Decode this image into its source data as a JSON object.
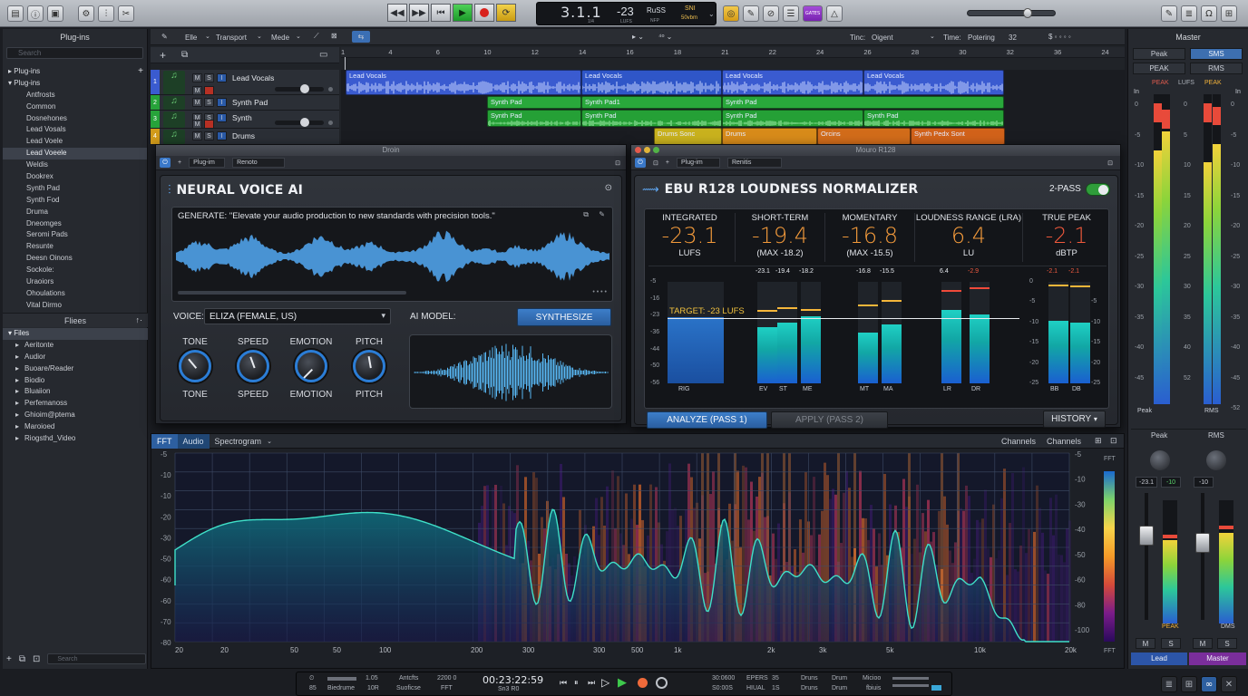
{
  "toolbar": {
    "lcd_position": "3.1.1",
    "lcd_position_sub": "1/4",
    "lcd_level": "-23",
    "lcd_level_sub": "LUFS",
    "lcd_field3": "RuSS",
    "lcd_field3_sub": "NFP",
    "lcd_field4": "SNI",
    "lcd_field4_sub": "50vbm",
    "gates_label": "GATES"
  },
  "sidebar": {
    "title": "Plug-ins",
    "search_placeholder": "Search",
    "tree_root": "Plug-ins",
    "tree_root2": "Plug-ins",
    "items": [
      "Antfrosts",
      "Common",
      "Dosnehones",
      "Lead Vosals",
      "Lead Voele",
      "Lead Voeele",
      "Weldis",
      "Dookrex",
      "Synth Pad",
      "Synth Fod",
      "Druma",
      "Dneomges",
      "Seromi Pads",
      "Resunte",
      "Deesn Oinons",
      "Sockole:",
      "Uraoiors",
      "Ohoulations",
      "Vital Dirmo"
    ],
    "files_title": "Fliees",
    "files_root": "Files",
    "files": [
      "Aeritonte",
      "Audior",
      "Buoare/Reader",
      "Biodio",
      "Bluaiion",
      "Perfemanoss",
      "Ghioim@ptema",
      "Maroioed",
      "Riogsthd_Video"
    ],
    "footer_search": "Search"
  },
  "arrange_toolbar": {
    "edit": "Elle",
    "transport": "Transport",
    "mode": "Mede",
    "time_label": "Tinc:",
    "time_value": "Oigent",
    "time2_label": "Time:",
    "time2_value": "Potering",
    "num": "32"
  },
  "ruler": [
    "1",
    "4",
    "6",
    "10",
    "12",
    "14",
    "16",
    "18",
    "21",
    "22",
    "24",
    "26",
    "28",
    "30",
    "32",
    "36",
    "24"
  ],
  "tracks": [
    {
      "num": "1",
      "name": "Lead Vocals",
      "color": "#3a5bd0"
    },
    {
      "num": "2",
      "name": "Synth Pad",
      "color": "#27a33a"
    },
    {
      "num": "3",
      "name": "Synth",
      "color": "#27a33a"
    },
    {
      "num": "4",
      "name": "Drums",
      "color": "#d19a1a"
    }
  ],
  "regions": {
    "vocal": [
      "Lead Vocals",
      "Lead Vocals",
      "Lead Vocals",
      "Lead Vocals"
    ],
    "synth1": [
      "Synth Pad",
      "Synth Pad1",
      "Synth Pad"
    ],
    "synth2": [
      "Synth Pad",
      "Synth Pad",
      "Synth Pad",
      "Synth Pad"
    ],
    "drums": [
      "Drums Sonc",
      "Drums",
      "Orcins",
      "Synth Pedx Sont"
    ]
  },
  "neural": {
    "window_title": "Droin",
    "bar_plugin": "Plug-im",
    "bar_preset": "Renoto",
    "title": "NEURAL VOICE AI",
    "prompt": "GENERATE: \"Elevate your audio production to new standards with precision tools.\"",
    "voice_label": "VOICE:",
    "voice_value": "ELIZA (FEMALE, US)",
    "model_label": "AI MODEL:",
    "synth_button": "SYNTHESIZE",
    "knobs": [
      {
        "top": "TONE",
        "bottom": "TONE",
        "angle": -40
      },
      {
        "top": "SPEED",
        "bottom": "SPEED",
        "angle": -20
      },
      {
        "top": "EMOTION",
        "bottom": "EMOTION",
        "angle": -135
      },
      {
        "top": "PITCH",
        "bottom": "PITCH",
        "angle": -10
      }
    ]
  },
  "ebu": {
    "window_title": "Mouro R128",
    "bar_plugin": "Plug-im",
    "bar_preset": "Renitis",
    "title": "EBU R128 LOUDNESS NORMALIZER",
    "two_pass": "2-PASS",
    "metrics": [
      {
        "label": "INTEGRATED",
        "value": "-23.1",
        "sub": "LUFS"
      },
      {
        "label": "SHORT-TERM",
        "value": "-19.4",
        "sub": "(MAX -18.2)"
      },
      {
        "label": "MOMENTARY",
        "value": "-16.8",
        "sub": "(MAX -15.5)"
      },
      {
        "label": "LOUDNESS RANGE (LRA)",
        "value": "6.4",
        "sub": "LU"
      },
      {
        "label": "TRUE PEAK",
        "value": "-2.1",
        "sub": "dBTP"
      }
    ],
    "target": "TARGET: -23 LUFS",
    "scale_left": [
      "-5",
      "-16",
      "-23",
      "-36",
      "-44",
      "-50",
      "-56"
    ],
    "scale_right": [
      "0",
      "-5",
      "-10",
      "-15",
      "-20",
      "-25"
    ],
    "scale_right2": [
      "-5",
      "-10",
      "-15",
      "-20",
      "-25"
    ],
    "groups": [
      {
        "label": "RIG",
        "bars": [
          {
            "lab": "",
            "level": 0.65,
            "peak": null
          }
        ]
      },
      {
        "label": "EV",
        "bars": [
          {
            "lab": "-23.1",
            "level": 0.55,
            "peak": 0.72
          }
        ]
      },
      {
        "label": "ST",
        "bars": [
          {
            "lab": "-19.4",
            "level": 0.6,
            "peak": 0.75
          }
        ]
      },
      {
        "label": "ME",
        "bars": [
          {
            "lab": "-18.2",
            "level": 0.66,
            "peak": 0.73
          }
        ]
      },
      {
        "label": "MT",
        "bars": [
          {
            "lab": "-16.8",
            "level": 0.5,
            "peak": 0.78
          }
        ]
      },
      {
        "label": "MA",
        "bars": [
          {
            "lab": "-15.5",
            "level": 0.58,
            "peak": 0.82
          }
        ]
      },
      {
        "label": "LR",
        "bars": [
          {
            "lab": "6.4",
            "level": 0.72,
            "peak": 0.92
          }
        ]
      },
      {
        "label": "DR",
        "bars": [
          {
            "lab": "-2.9",
            "level": 0.68,
            "peak": 0.95
          }
        ]
      },
      {
        "label": "BB",
        "bars": [
          {
            "lab": "-2.1",
            "level": 0.62,
            "peak": 0.97
          }
        ]
      },
      {
        "label": "DB",
        "bars": [
          {
            "lab": "-2.1",
            "level": 0.6,
            "peak": 0.96
          }
        ]
      }
    ],
    "analyze_button": "ANALYZE (PASS 1)",
    "apply_button": "APPLY (PASS 2)",
    "history_button": "HISTORY"
  },
  "spectrum": {
    "tab_fft": "FFT",
    "tab_audio": "Audio",
    "tab_spectrogram": "Spectrogram",
    "channels1": "Channels",
    "channels2": "Channels",
    "y_left": [
      "-5",
      "-10",
      "-10",
      "-20",
      "-30",
      "-50",
      "-60",
      "-60",
      "-70",
      "-80"
    ],
    "y_right": [
      "-5",
      "-10",
      "-30",
      "-40",
      "-50",
      "-60",
      "-80",
      "-100"
    ],
    "x_labels": [
      "20",
      "20",
      "50",
      "50",
      "100",
      "200",
      "300",
      "300",
      "500",
      "1k",
      "2k",
      "3k",
      "5k",
      "10k",
      "20k"
    ],
    "fft_right": "FFT"
  },
  "master": {
    "title": "Master",
    "row1": [
      "Peak",
      "SMS"
    ],
    "row2": [
      "PEAK",
      "RMS"
    ],
    "col_labels": [
      "PEAK",
      "LUFS",
      "PEAK"
    ],
    "scale1": [
      "0",
      "-5",
      "-10",
      "-15",
      "-20",
      "-25",
      "-30",
      "-35",
      "-40",
      "-45"
    ],
    "scale2": [
      "0",
      "5",
      "10",
      "15",
      "20",
      "25",
      "30",
      "35",
      "40",
      "52"
    ],
    "scale3": [
      "0",
      "-5",
      "-10",
      "-15",
      "-20",
      "-25",
      "-30",
      "-35",
      "-40",
      "-45",
      "-52"
    ],
    "foot_left": "Peak",
    "foot_right": "RMS",
    "knob_left": "Peak",
    "knob_right": "RMS",
    "val_a": "-23.1",
    "val_b": "-10",
    "val_c": "-10",
    "peak_small": "PEAK",
    "dms_small": "DMS",
    "m": "M",
    "s": "S",
    "lead": "Lead",
    "master": "Master"
  },
  "transport": {
    "t1a": "1.05",
    "t1b": "10R",
    "t2a": "Antcfts",
    "t2b": "Suoficse",
    "t3a": "2200 0",
    "t3b": "FFT",
    "time": "00:23:22:59",
    "time_sub": "Sn3 R0",
    "s1a": "30:0600",
    "s1b": "S0:00S",
    "s2a": "EPERS",
    "s2b": "HIUAL",
    "s3a": "35",
    "s3b": "1S",
    "s4a": "Druns",
    "s4b": "Druns",
    "s5a": "Drum",
    "s5b": "Drum",
    "s6a": "Micioo",
    "s6b": "fbiuis",
    "left_a": "85",
    "left_b": "Biedrume"
  }
}
